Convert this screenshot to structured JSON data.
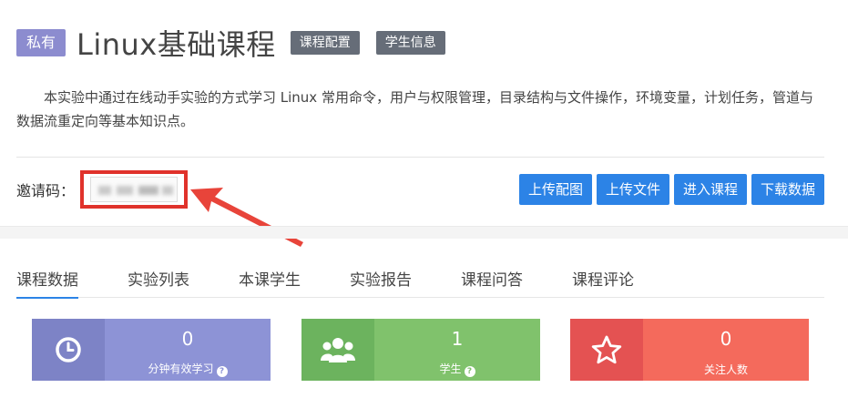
{
  "header": {
    "badge": "私有",
    "title": "Linux基础课程",
    "tags": [
      "课程配置",
      "学生信息"
    ]
  },
  "description": "本实验中通过在线动手实验的方式学习 Linux 常用命令，用户与权限管理，目录结构与文件操作，环境变量，计划任务，管道与数据流重定向等基本知识点。",
  "invite": {
    "label": "邀请码："
  },
  "actions": [
    "上传配图",
    "上传文件",
    "进入课程",
    "下载数据"
  ],
  "tabs": [
    "课程数据",
    "实验列表",
    "本课学生",
    "实验报告",
    "课程问答",
    "课程评论"
  ],
  "stats": [
    {
      "value": "0",
      "label": "分钟有效学习",
      "help": "?",
      "icon": "clock-icon",
      "icon_bg": "#7d83c6",
      "body_bg": "#8d93d6"
    },
    {
      "value": "1",
      "label": "学生",
      "help": "?",
      "icon": "users-icon",
      "icon_bg": "#6cb35e",
      "body_bg": "#80c26c"
    },
    {
      "value": "0",
      "label": "关注人数",
      "icon": "star-icon",
      "icon_bg": "#e45252",
      "body_bg": "#f46a5c"
    }
  ],
  "colors": {
    "primary": "#2c83e6",
    "highlight": "#e0322b"
  }
}
